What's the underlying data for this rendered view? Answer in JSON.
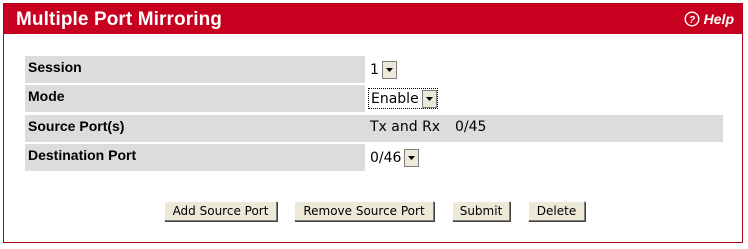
{
  "header": {
    "title": "Multiple Port Mirroring",
    "help_label": "Help",
    "accent_color": "#c8001f",
    "help_icon": "question-circle-icon"
  },
  "form": {
    "session": {
      "label": "Session",
      "value": "1"
    },
    "mode": {
      "label": "Mode",
      "value": "Enable"
    },
    "source_ports": {
      "label": "Source Port(s)",
      "direction": "Tx and Rx",
      "port": "0/45"
    },
    "destination_port": {
      "label": "Destination Port",
      "value": "0/46"
    }
  },
  "actions": {
    "add_source_port": "Add Source Port",
    "remove_source_port": "Remove Source Port",
    "submit": "Submit",
    "delete": "Delete"
  }
}
